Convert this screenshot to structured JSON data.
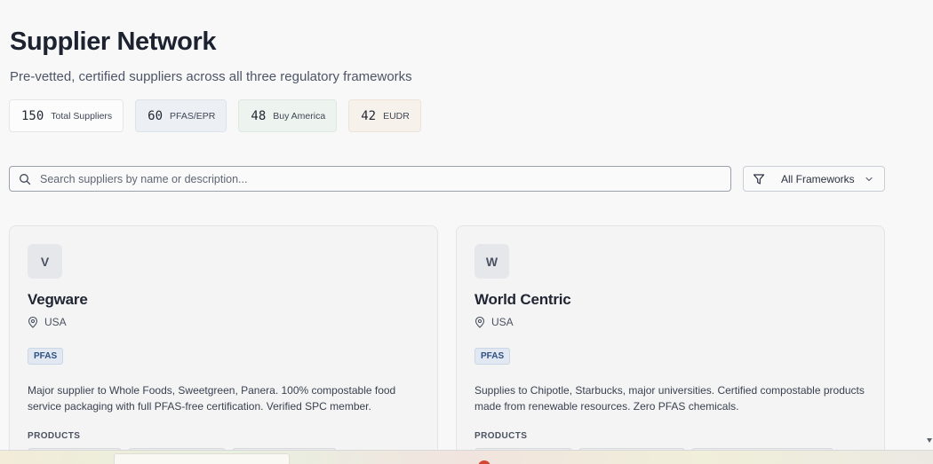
{
  "header": {
    "title": "Supplier Network",
    "subtitle": "Pre-vetted, certified suppliers across all three regulatory frameworks"
  },
  "stats": [
    {
      "value": "150",
      "label": "Total Suppliers"
    },
    {
      "value": "60",
      "label": "PFAS/EPR"
    },
    {
      "value": "48",
      "label": "Buy America"
    },
    {
      "value": "42",
      "label": "EUDR"
    }
  ],
  "search": {
    "placeholder": "Search suppliers by name or description...",
    "value": "",
    "icon": "search-icon"
  },
  "filter": {
    "selected": "All Frameworks",
    "icon": "filter-icon"
  },
  "suppliers": [
    {
      "initial": "V",
      "name": "Vegware",
      "location": "USA",
      "tag": "PFAS",
      "description": "Major supplier to Whole Foods, Sweetgreen, Panera. 100% compostable food service packaging with full PFAS-free certification. Verified SPC member.",
      "products_label": "PRODUCTS"
    },
    {
      "initial": "W",
      "name": "World Centric",
      "location": "USA",
      "tag": "PFAS",
      "description": "Supplies to Chipotle, Starbucks, major universities. Certified compostable products made from renewable resources. Zero PFAS chemicals.",
      "products_label": "PRODUCTS"
    }
  ],
  "colors": {
    "page_background": "#f8f8f8",
    "pfas_tag": "#2e4f80",
    "pfas_stat_bg": "#ecf0f5",
    "buy_america_stat_bg": "#edf3ee",
    "eudr_stat_bg": "#f7f1ec"
  }
}
